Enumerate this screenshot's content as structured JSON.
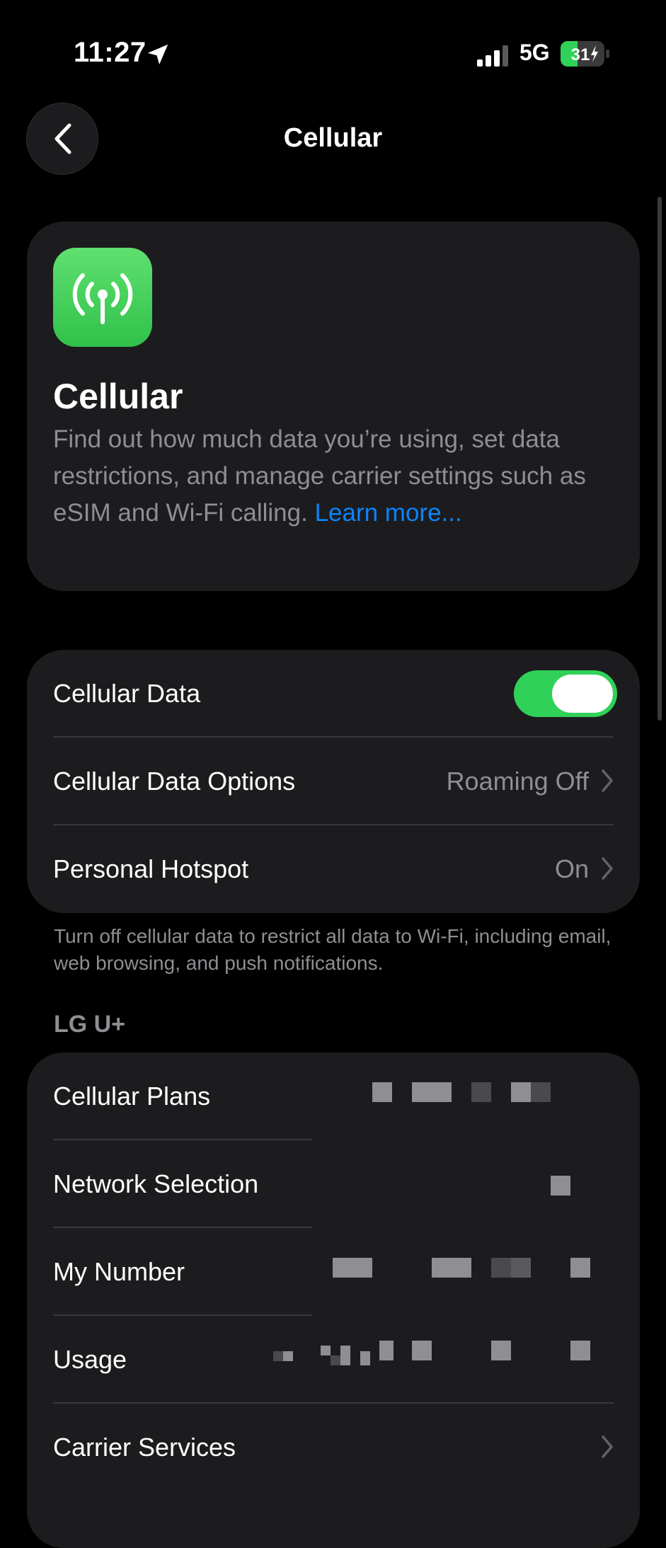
{
  "status_bar": {
    "time": "11:27",
    "network": "5G",
    "battery": "31"
  },
  "nav": {
    "title": "Cellular"
  },
  "hero": {
    "title": "Cellular",
    "description": "Find out how much data you’re using, set data restrictions, and manage carrier settings such as eSIM and Wi-Fi calling. ",
    "link": "Learn more..."
  },
  "settings": {
    "cellular_data": {
      "label": "Cellular Data",
      "enabled": true
    },
    "cellular_data_options": {
      "label": "Cellular Data Options",
      "value": "Roaming Off"
    },
    "personal_hotspot": {
      "label": "Personal Hotspot",
      "value": "On"
    },
    "footer": "Turn off cellular data to restrict all data to Wi-Fi, including email, web browsing, and push notifications."
  },
  "carrier": {
    "header": "LG U+",
    "items": [
      {
        "label": "Cellular Plans"
      },
      {
        "label": "Network Selection"
      },
      {
        "label": "My Number"
      },
      {
        "label": "Usage"
      },
      {
        "label": "Carrier Services"
      }
    ]
  },
  "colors": {
    "accent": "#0a84ff",
    "toggle_on": "#30d158",
    "card": "#1c1c1e",
    "secondary_text": "#8e8e93"
  }
}
